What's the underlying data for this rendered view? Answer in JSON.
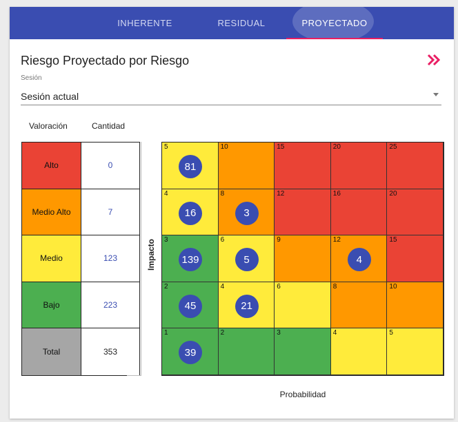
{
  "tabs": [
    {
      "label": "INHERENTE",
      "active": false
    },
    {
      "label": "RESIDUAL",
      "active": false
    },
    {
      "label": "PROYECTADO",
      "active": true
    }
  ],
  "colors": {
    "accent": "#3a4db1",
    "indicator": "#e91e63",
    "alto": "#ea4335",
    "medio_alto": "#ff9800",
    "medio": "#ffeb3b",
    "bajo": "#4caf50",
    "total": "#a6a6a6",
    "count_link": "#3a4db1"
  },
  "header": {
    "title": "Riesgo Proyectado por Riesgo",
    "expand_icon": "double-chevron-right-icon"
  },
  "session": {
    "label": "Sesión",
    "value": "Sesión actual",
    "icon": "dropdown-arrow-icon"
  },
  "legend": {
    "col_valoracion": "Valoración",
    "col_cantidad": "Cantidad",
    "rows": [
      {
        "label": "Alto",
        "count": "0",
        "color": "#ea4335",
        "link": true
      },
      {
        "label": "Medio Alto",
        "count": "7",
        "color": "#ff9800",
        "link": true
      },
      {
        "label": "Medio",
        "count": "123",
        "color": "#ffeb3b",
        "link": true
      },
      {
        "label": "Bajo",
        "count": "223",
        "color": "#4caf50",
        "link": true
      },
      {
        "label": "Total",
        "count": "353",
        "color": "#a6a6a6",
        "link": false
      }
    ]
  },
  "axis": {
    "y_label": "Impacto",
    "x_label": "Probabilidad"
  },
  "matrix": {
    "rows": [
      [
        {
          "n": "5",
          "c": "#ffeb3b",
          "b": "81"
        },
        {
          "n": "10",
          "c": "#ff9800",
          "b": ""
        },
        {
          "n": "15",
          "c": "#ea4335",
          "b": ""
        },
        {
          "n": "20",
          "c": "#ea4335",
          "b": ""
        },
        {
          "n": "25",
          "c": "#ea4335",
          "b": ""
        }
      ],
      [
        {
          "n": "4",
          "c": "#ffeb3b",
          "b": "16"
        },
        {
          "n": "8",
          "c": "#ff9800",
          "b": "3"
        },
        {
          "n": "12",
          "c": "#ea4335",
          "b": ""
        },
        {
          "n": "16",
          "c": "#ea4335",
          "b": ""
        },
        {
          "n": "20",
          "c": "#ea4335",
          "b": ""
        }
      ],
      [
        {
          "n": "3",
          "c": "#4caf50",
          "b": "139"
        },
        {
          "n": "6",
          "c": "#ffeb3b",
          "b": "5"
        },
        {
          "n": "9",
          "c": "#ff9800",
          "b": ""
        },
        {
          "n": "12",
          "c": "#ff9800",
          "b": "4"
        },
        {
          "n": "15",
          "c": "#ea4335",
          "b": ""
        }
      ],
      [
        {
          "n": "2",
          "c": "#4caf50",
          "b": "45"
        },
        {
          "n": "4",
          "c": "#ffeb3b",
          "b": "21"
        },
        {
          "n": "6",
          "c": "#ffeb3b",
          "b": ""
        },
        {
          "n": "8",
          "c": "#ff9800",
          "b": ""
        },
        {
          "n": "10",
          "c": "#ff9800",
          "b": ""
        }
      ],
      [
        {
          "n": "1",
          "c": "#4caf50",
          "b": "39"
        },
        {
          "n": "2",
          "c": "#4caf50",
          "b": ""
        },
        {
          "n": "3",
          "c": "#4caf50",
          "b": ""
        },
        {
          "n": "4",
          "c": "#ffeb3b",
          "b": ""
        },
        {
          "n": "5",
          "c": "#ffeb3b",
          "b": ""
        }
      ]
    ]
  }
}
